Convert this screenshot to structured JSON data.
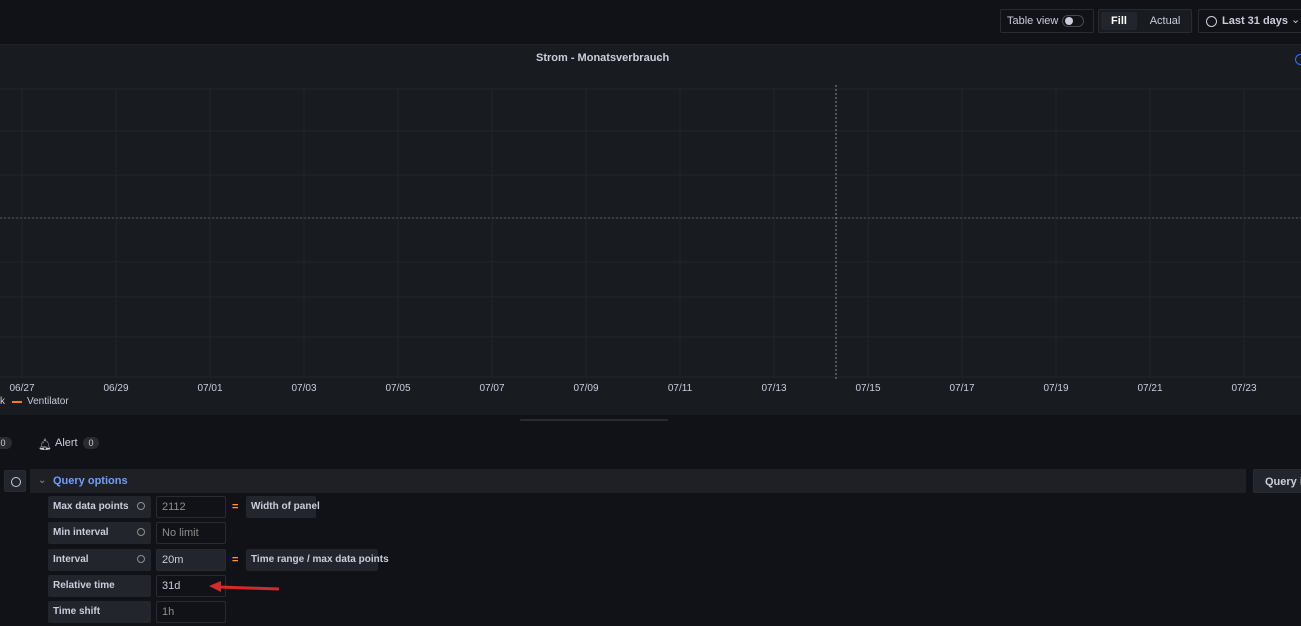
{
  "toolbar": {
    "table_view_label": "Table view",
    "fill_label": "Fill",
    "actual_label": "Actual",
    "time_range_label": "Last 31 days"
  },
  "panel": {
    "title": "Strom - Monatsverbrauch",
    "legend_prev_fragment": "k",
    "legend_item": "Ventilator",
    "legend_color": "#ff780a"
  },
  "chart_data": {
    "type": "line",
    "x_tick_labels": [
      "06/27",
      "06/29",
      "07/01",
      "07/03",
      "07/05",
      "07/07",
      "07/09",
      "07/11",
      "07/13",
      "07/15",
      "07/17",
      "07/19",
      "07/21",
      "07/23"
    ],
    "series": [
      {
        "name": "Ventilator",
        "values": []
      }
    ],
    "grid": true,
    "legend_placement": "bottom-left"
  },
  "tabs": {
    "first_badge": "0",
    "alert_label": "Alert",
    "alert_badge": "0"
  },
  "query_options": {
    "title": "Query options",
    "query_inspector_label": "Query in",
    "rows": {
      "max_data_points": {
        "label": "Max data points",
        "value": "2112",
        "desc": "Width of panel"
      },
      "min_interval": {
        "label": "Min interval",
        "placeholder": "No limit"
      },
      "interval": {
        "label": "Interval",
        "value": "20m",
        "desc": "Time range / max data points"
      },
      "relative_time": {
        "label": "Relative time",
        "value": "31d"
      },
      "time_shift": {
        "label": "Time shift",
        "placeholder": "1h"
      }
    },
    "equals_sign": "="
  },
  "colors": {
    "accent_blue": "#6e9fff",
    "orange": "#ff9830",
    "annotation_red": "#d42a2a"
  }
}
